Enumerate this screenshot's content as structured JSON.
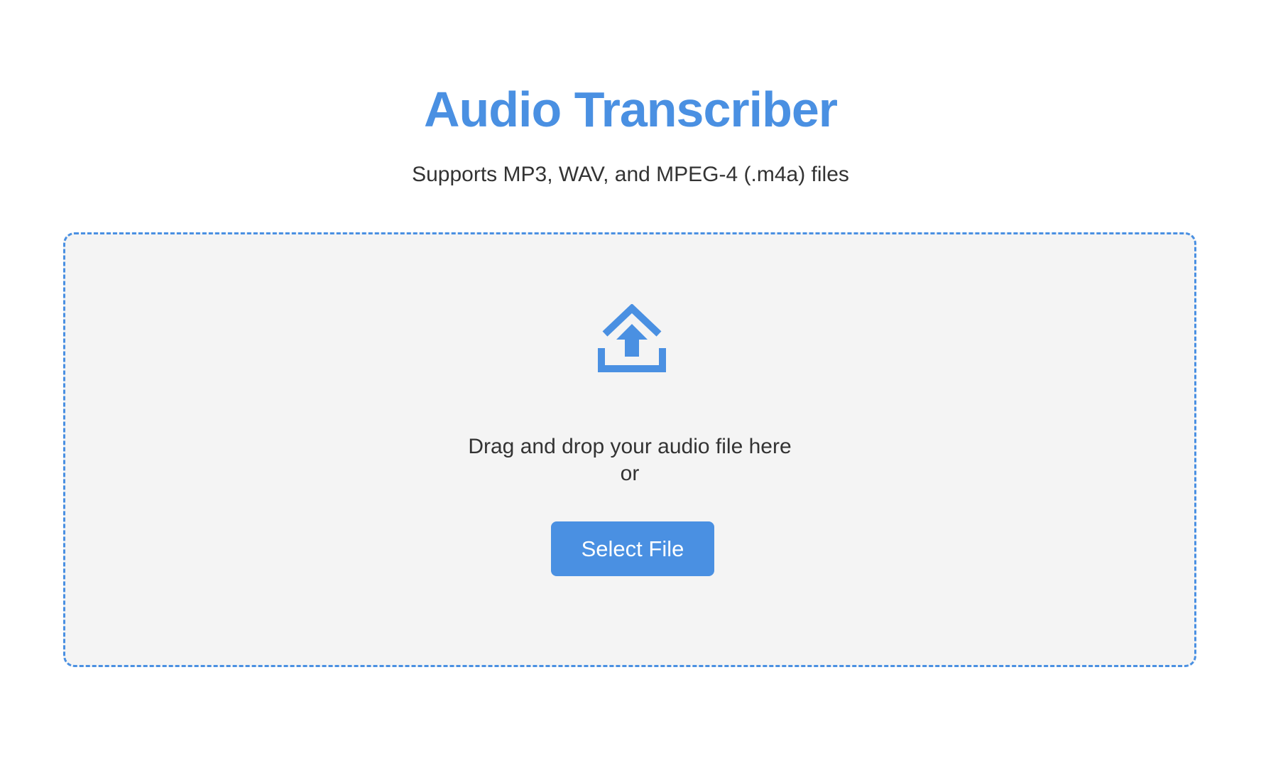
{
  "header": {
    "title": "Audio Transcriber",
    "subtitle": "Supports MP3, WAV, and MPEG-4 (.m4a) files"
  },
  "dropzone": {
    "icon": "upload-icon",
    "instruction": "Drag and drop your audio file here",
    "or_text": "or",
    "button_label": "Select File"
  },
  "colors": {
    "accent": "#4a90e2",
    "text": "#333333",
    "dropzone_background": "#f4f4f4"
  }
}
